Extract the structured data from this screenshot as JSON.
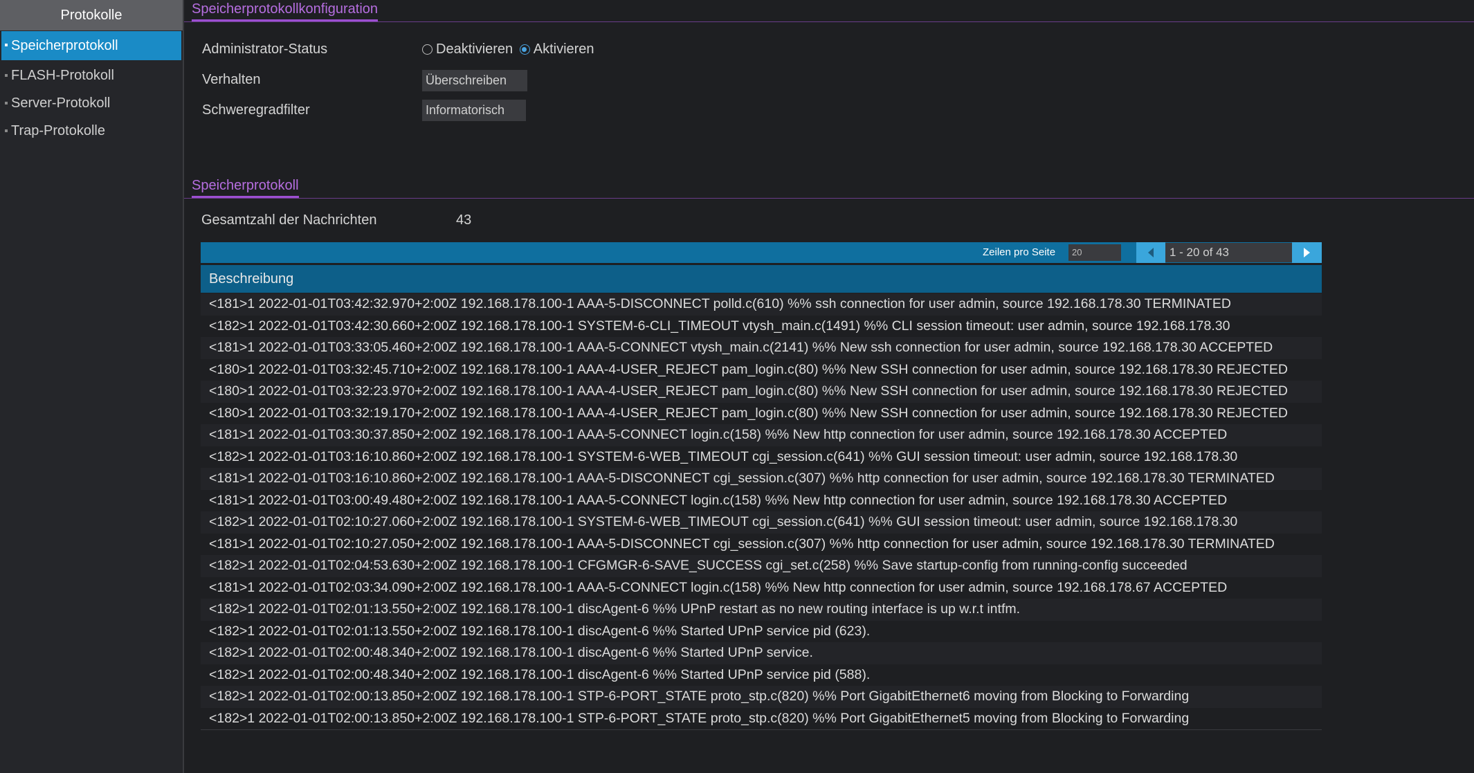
{
  "sidebar": {
    "header": "Protokolle",
    "items": [
      {
        "label": "Speicherprotokoll"
      },
      {
        "label": "FLASH-Protokoll"
      },
      {
        "label": "Server-Protokoll"
      },
      {
        "label": "Trap-Protokolle"
      }
    ]
  },
  "config": {
    "title": "Speicherprotokollkonfiguration",
    "admin_status_label": "Administrator-Status",
    "radio_deactivate": "Deaktivieren",
    "radio_activate": "Aktivieren",
    "behavior_label": "Verhalten",
    "behavior_value": "Überschreiben",
    "severity_label": "Schweregradfilter",
    "severity_value": "Informatorisch"
  },
  "log": {
    "title": "Speicherprotokoll",
    "total_label": "Gesamtzahl der Nachrichten",
    "total_value": "43",
    "rows_per_page_label": "Zeilen pro Seite",
    "rows_per_page_value": "20",
    "page_range": "1 - 20 of 43",
    "column_header": "Beschreibung",
    "rows": [
      "<181>1 2022-01-01T03:42:32.970+2:00Z 192.168.178.100-1 AAA-5-DISCONNECT polld.c(610) %% ssh connection for user admin, source 192.168.178.30  TERMINATED",
      "<182>1 2022-01-01T03:42:30.660+2:00Z 192.168.178.100-1 SYSTEM-6-CLI_TIMEOUT vtysh_main.c(1491) %% CLI session timeout: user admin, source 192.168.178.30",
      "<181>1 2022-01-01T03:33:05.460+2:00Z 192.168.178.100-1 AAA-5-CONNECT vtysh_main.c(2141) %% New ssh connection for user admin, source 192.168.178.30 ACCEPTED",
      "<180>1 2022-01-01T03:32:45.710+2:00Z 192.168.178.100-1 AAA-4-USER_REJECT pam_login.c(80) %% New SSH connection for user admin, source 192.168.178.30 REJECTED",
      "<180>1 2022-01-01T03:32:23.970+2:00Z 192.168.178.100-1 AAA-4-USER_REJECT pam_login.c(80) %% New SSH connection for user admin, source 192.168.178.30 REJECTED",
      "<180>1 2022-01-01T03:32:19.170+2:00Z 192.168.178.100-1 AAA-4-USER_REJECT pam_login.c(80) %% New SSH connection for user admin, source 192.168.178.30 REJECTED",
      "<181>1 2022-01-01T03:30:37.850+2:00Z 192.168.178.100-1 AAA-5-CONNECT login.c(158) %% New http connection for user admin, source 192.168.178.30 ACCEPTED",
      "<182>1 2022-01-01T03:16:10.860+2:00Z 192.168.178.100-1 SYSTEM-6-WEB_TIMEOUT cgi_session.c(641) %% GUI session timeout: user admin, source 192.168.178.30",
      "<181>1 2022-01-01T03:16:10.860+2:00Z 192.168.178.100-1 AAA-5-DISCONNECT cgi_session.c(307) %% http connection for user admin, source 192.168.178.30 TERMINATED",
      "<181>1 2022-01-01T03:00:49.480+2:00Z 192.168.178.100-1 AAA-5-CONNECT login.c(158) %% New http connection for user admin, source 192.168.178.30 ACCEPTED",
      "<182>1 2022-01-01T02:10:27.060+2:00Z 192.168.178.100-1 SYSTEM-6-WEB_TIMEOUT cgi_session.c(641) %% GUI session timeout: user admin, source 192.168.178.30",
      "<181>1 2022-01-01T02:10:27.050+2:00Z 192.168.178.100-1 AAA-5-DISCONNECT cgi_session.c(307) %% http connection for user admin, source 192.168.178.30 TERMINATED",
      "<182>1 2022-01-01T02:04:53.630+2:00Z 192.168.178.100-1 CFGMGR-6-SAVE_SUCCESS cgi_set.c(258) %% Save startup-config from running-config succeeded",
      "<181>1 2022-01-01T02:03:34.090+2:00Z 192.168.178.100-1 AAA-5-CONNECT login.c(158) %% New http connection for user admin, source 192.168.178.67 ACCEPTED",
      "<182>1 2022-01-01T02:01:13.550+2:00Z 192.168.178.100-1 discAgent-6 %% UPnP restart as no new routing interface is up w.r.t intfm.",
      "<182>1 2022-01-01T02:01:13.550+2:00Z 192.168.178.100-1 discAgent-6 %% Started UPnP service pid (623).",
      "<182>1 2022-01-01T02:00:48.340+2:00Z 192.168.178.100-1 discAgent-6 %% Started UPnP service.",
      "<182>1 2022-01-01T02:00:48.340+2:00Z 192.168.178.100-1 discAgent-6 %% Started UPnP service pid (588).",
      "<182>1 2022-01-01T02:00:13.850+2:00Z 192.168.178.100-1 STP-6-PORT_STATE proto_stp.c(820) %% Port GigabitEthernet6 moving from Blocking to Forwarding",
      "<182>1 2022-01-01T02:00:13.850+2:00Z 192.168.178.100-1 STP-6-PORT_STATE proto_stp.c(820) %% Port GigabitEthernet5 moving from Blocking to Forwarding"
    ]
  }
}
